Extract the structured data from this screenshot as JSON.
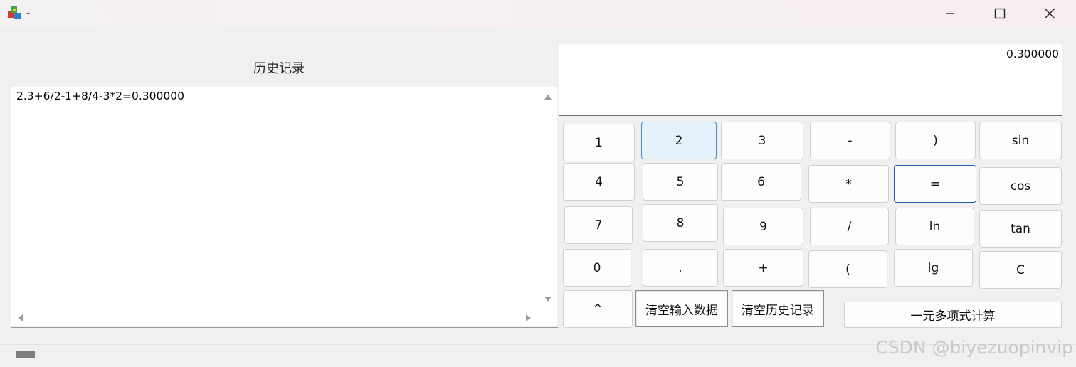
{
  "window": {
    "title": "-",
    "minimize_icon": "minimize-icon",
    "maximize_icon": "maximize-icon",
    "close_icon": "close-icon"
  },
  "history": {
    "label": "历史记录",
    "entries": [
      "2.3+6/2-1+8/4-3*2=0.300000"
    ]
  },
  "display": {
    "value": "0.300000"
  },
  "keypad": {
    "k1": "1",
    "k2": "2",
    "k3": "3",
    "minus": "-",
    "rparen": ")",
    "sin": "sin",
    "k4": "4",
    "k5": "5",
    "k6": "6",
    "mul": "*",
    "equals": "=",
    "cos": "cos",
    "k7": "7",
    "k8": "8",
    "k9": "9",
    "div": "/",
    "ln": "ln",
    "tan": "tan",
    "k0": "0",
    "dot": ".",
    "plus": "+",
    "lparen": "(",
    "lg": "lg",
    "clear": "C",
    "pow": "^",
    "clear_input": "清空输入数据",
    "clear_history": "清空历史记录",
    "polynomial": "一元多项式计算"
  },
  "watermark": "CSDN @biyezuopinvip"
}
